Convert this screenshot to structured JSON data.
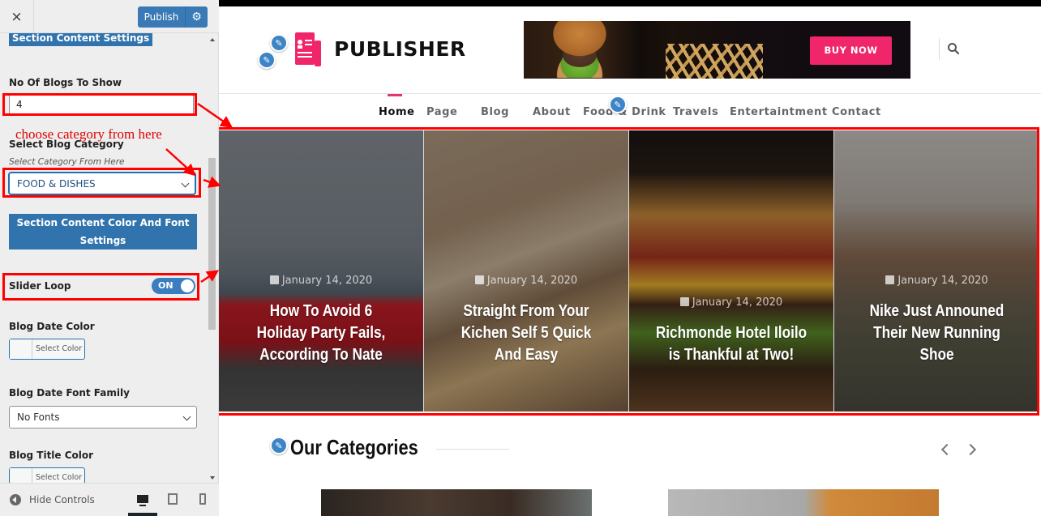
{
  "customizer": {
    "close_label": "×",
    "publish_label": "Publish",
    "section_settings_label": "Section Content Settings",
    "blogs_to_show": {
      "label": "No Of Blogs To Show",
      "value": "4"
    },
    "annotation": "choose category from here",
    "blog_category": {
      "label": "Select Blog Category",
      "description": "Select Category From Here",
      "selected": "FOOD & DISHES"
    },
    "color_font_settings_label": [
      "Section Content Color And Font",
      "Settings"
    ],
    "slider_loop": {
      "label": "Slider Loop",
      "state": "ON"
    },
    "blog_date_color": {
      "label": "Blog Date Color",
      "button": "Select Color"
    },
    "blog_date_font": {
      "label": "Blog Date Font Family",
      "selected": "No Fonts"
    },
    "blog_title_color": {
      "label": "Blog Title Color",
      "button": "Select Color"
    },
    "footer": {
      "hide_controls": "Hide Controls",
      "devices": [
        "desktop",
        "tablet",
        "mobile"
      ],
      "active_device": "desktop"
    }
  },
  "site": {
    "logo_text": "PUBLISHER",
    "brand_color": "#f0256a",
    "ad": {
      "cta": "BUY NOW"
    },
    "nav": [
      {
        "label": "Home",
        "active": true
      },
      {
        "label": "Page"
      },
      {
        "label": "Blog"
      },
      {
        "label": "About"
      },
      {
        "label": "Food & Drink"
      },
      {
        "label": "Travels"
      },
      {
        "label": "Entertaintment"
      },
      {
        "label": "Contact"
      }
    ],
    "slides": [
      {
        "date": "January 14, 2020",
        "title": "How To Avoid 6 Holiday Party Fails, According To Nate"
      },
      {
        "date": "January 14, 2020",
        "title": "Straight From Your Kichen Self 5 Quick And Easy"
      },
      {
        "date": "January 14, 2020",
        "title": "Richmonde Hotel Iloilo is Thankful at Two!"
      },
      {
        "date": "January 14, 2020",
        "title": "Nike Just Announed Their New Running Shoe"
      }
    ],
    "categories_title": "Our Categories"
  }
}
